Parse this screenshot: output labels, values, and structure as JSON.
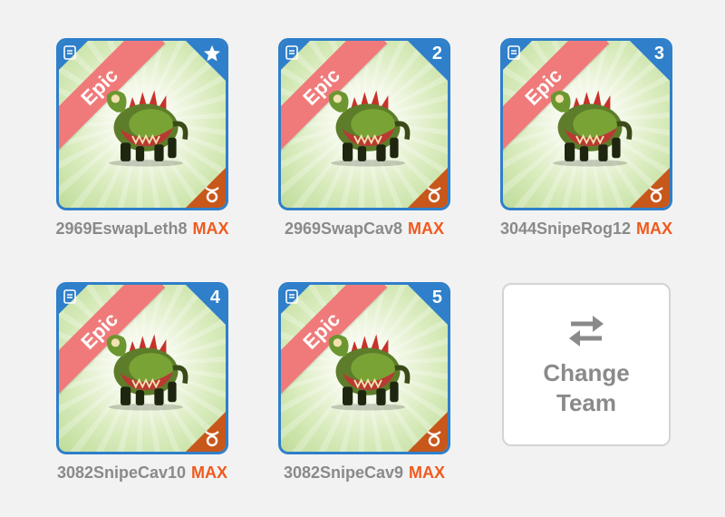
{
  "team": [
    {
      "rarity": "Epic",
      "badge": "★",
      "badge_type": "leader-star",
      "name": "2969EswapLeth8",
      "level_tag": "MAX",
      "sign_icon": "taurus-icon"
    },
    {
      "rarity": "Epic",
      "badge": "2",
      "badge_type": "number",
      "name": "2969SwapCav8",
      "level_tag": "MAX",
      "sign_icon": "taurus-icon"
    },
    {
      "rarity": "Epic",
      "badge": "3",
      "badge_type": "number",
      "name": "3044SnipeRog12",
      "level_tag": "MAX",
      "sign_icon": "taurus-icon"
    },
    {
      "rarity": "Epic",
      "badge": "4",
      "badge_type": "number",
      "name": "3082SnipeCav10",
      "level_tag": "MAX",
      "sign_icon": "taurus-icon"
    },
    {
      "rarity": "Epic",
      "badge": "5",
      "badge_type": "number",
      "name": "3082SnipeCav9",
      "level_tag": "MAX",
      "sign_icon": "taurus-icon"
    }
  ],
  "change_team": {
    "line1": "Change",
    "line2": "Team",
    "icon": "swap-arrows-icon"
  },
  "colors": {
    "frame": "#2f7fca",
    "ribbon": "#f07a7a",
    "element_corner": "#c7571b",
    "max": "#f05a1e",
    "name": "#8a8a8a"
  }
}
